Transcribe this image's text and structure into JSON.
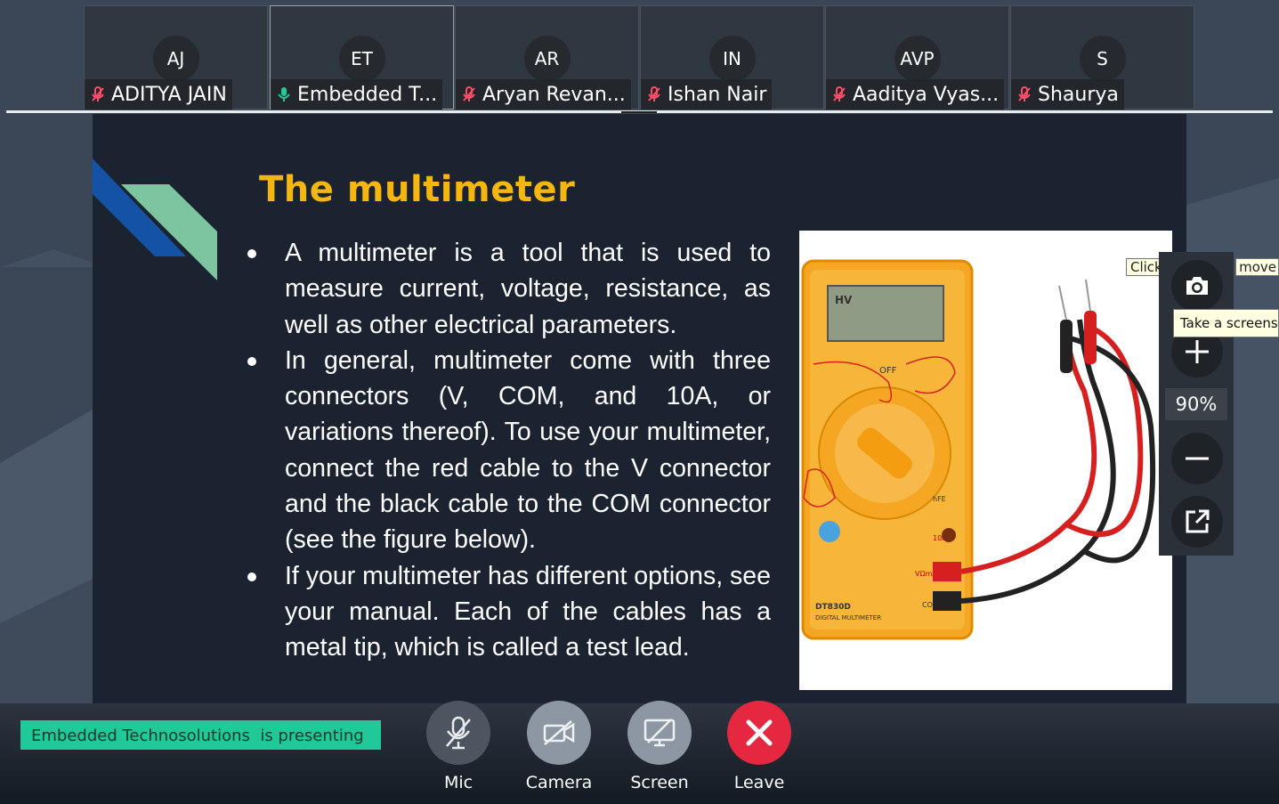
{
  "participants": [
    {
      "initials": "AJ",
      "name": "ADITYA JAIN",
      "mic": "muted"
    },
    {
      "initials": "ET",
      "name": "Embedded T...",
      "mic": "on"
    },
    {
      "initials": "AR",
      "name": "Aryan Revan...",
      "mic": "muted"
    },
    {
      "initials": "IN",
      "name": "Ishan Nair",
      "mic": "muted"
    },
    {
      "initials": "AVP",
      "name": "Aaditya Vyas...",
      "mic": "muted"
    },
    {
      "initials": "S",
      "name": "Shaurya",
      "mic": "muted"
    }
  ],
  "slide": {
    "title": "The multimeter",
    "bullets": [
      "A multimeter is a tool that is used to measure current, voltage, resistance, as well as other electrical parameters.",
      "In general, multimeter come with three connectors (V, COM, and 10A, or variations thereof). To use your multimeter, connect the red cable to the V connector and the black cable to the COM connector (see the figure below).",
      "If your multimeter has different options, see your manual. Each of the cables has a metal tip, which is called a test lead."
    ],
    "image": {
      "display_label": "HV",
      "model_label": "DT830D",
      "model_sub": "DIGITAL MULTIMETER",
      "off_label": "OFF",
      "com_label": "COM",
      "ten_a_label": "10A",
      "vomega_label": "VΩmA",
      "hfe_label": "hFE"
    }
  },
  "zoom": {
    "level": "90%",
    "tooltip": "Take a screenshot",
    "hint_left": "Click",
    "hint_right": "move"
  },
  "presenting_text": "Embedded Technosolutions  is presenting",
  "controls": {
    "mic": "Mic",
    "camera": "Camera",
    "screen": "Screen",
    "leave": "Leave"
  },
  "colors": {
    "accent_title": "#f4b60f",
    "presenting_bg": "#20c997",
    "leave": "#e5283f",
    "active_mic": "#20c997",
    "muted_mic": "#ff4d6a"
  }
}
